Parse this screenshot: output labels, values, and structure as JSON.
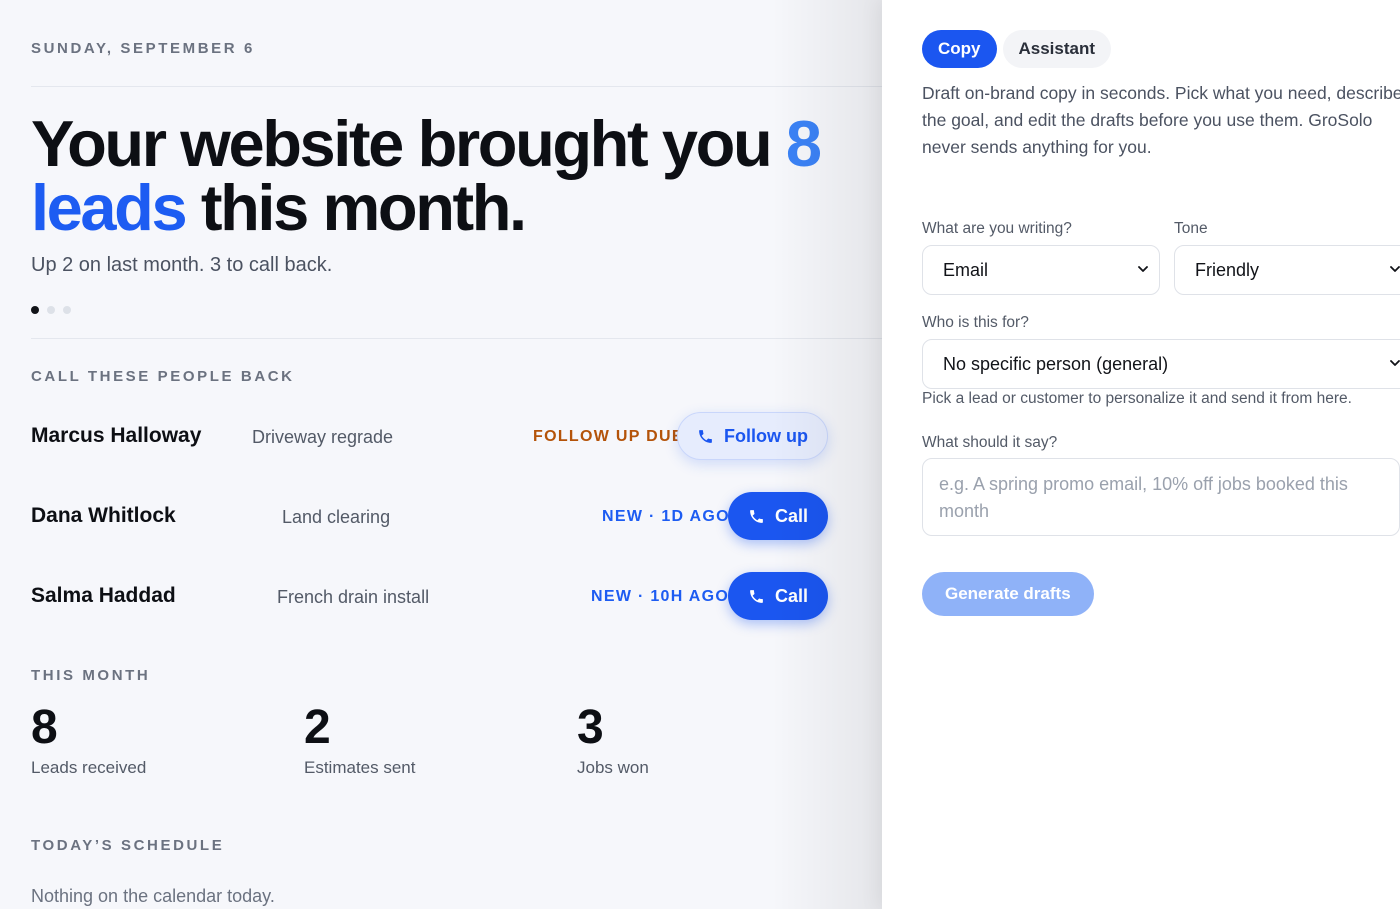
{
  "dashboard": {
    "date": "SUNDAY, SEPTEMBER 6",
    "headline": {
      "prefix": "Your website brought you ",
      "count": "8",
      "unit": "leads",
      "suffix": " this month."
    },
    "subheading": "Up 2 on last month. 3 to call back.",
    "carousel": {
      "total": 3,
      "active_index": 0
    },
    "callbacks_title": "CALL THESE PEOPLE BACK",
    "callbacks": [
      {
        "name": "Marcus Halloway",
        "job": "Driveway regrade",
        "status": "FOLLOW UP DUE",
        "action": "Follow up"
      },
      {
        "name": "Dana Whitlock",
        "job": "Land clearing",
        "status": "NEW · 1D AGO",
        "action": "Call"
      },
      {
        "name": "Salma Haddad",
        "job": "French drain install",
        "status": "NEW · 10H AGO",
        "action": "Call"
      }
    ],
    "month_title": "THIS MONTH",
    "stats": [
      {
        "value": "8",
        "label": "Leads received"
      },
      {
        "value": "2",
        "label": "Estimates sent"
      },
      {
        "value": "3",
        "label": "Jobs won"
      }
    ],
    "schedule_title": "TODAY’S SCHEDULE",
    "schedule_empty": "Nothing on the calendar today."
  },
  "panel": {
    "tabs": [
      {
        "label": "Copy",
        "active": true
      },
      {
        "label": "Assistant",
        "active": false
      }
    ],
    "intro": "Draft on-brand copy in seconds. Pick what you need, describe the goal, and edit the drafts before you use them. GroSolo never sends anything for you.",
    "writing_label": "What are you writing?",
    "writing_value": "Email",
    "tone_label": "Tone",
    "tone_value": "Friendly",
    "recipient_label": "Who is this for?",
    "recipient_value": "No specific person (general)",
    "recipient_hint": "Pick a lead or customer to personalize it and send it from here.",
    "message_label": "What should it say?",
    "message_placeholder": "e.g. A spring promo email, 10% off jobs booked this month",
    "generate_label": "Generate drafts"
  },
  "colors": {
    "accent": "#1b56f0",
    "accent_light": "#3b82f6",
    "warning": "#b45309",
    "disabled_button": "#8fb2f8"
  },
  "icons": [
    "phone-icon",
    "chevron-down-icon"
  ]
}
